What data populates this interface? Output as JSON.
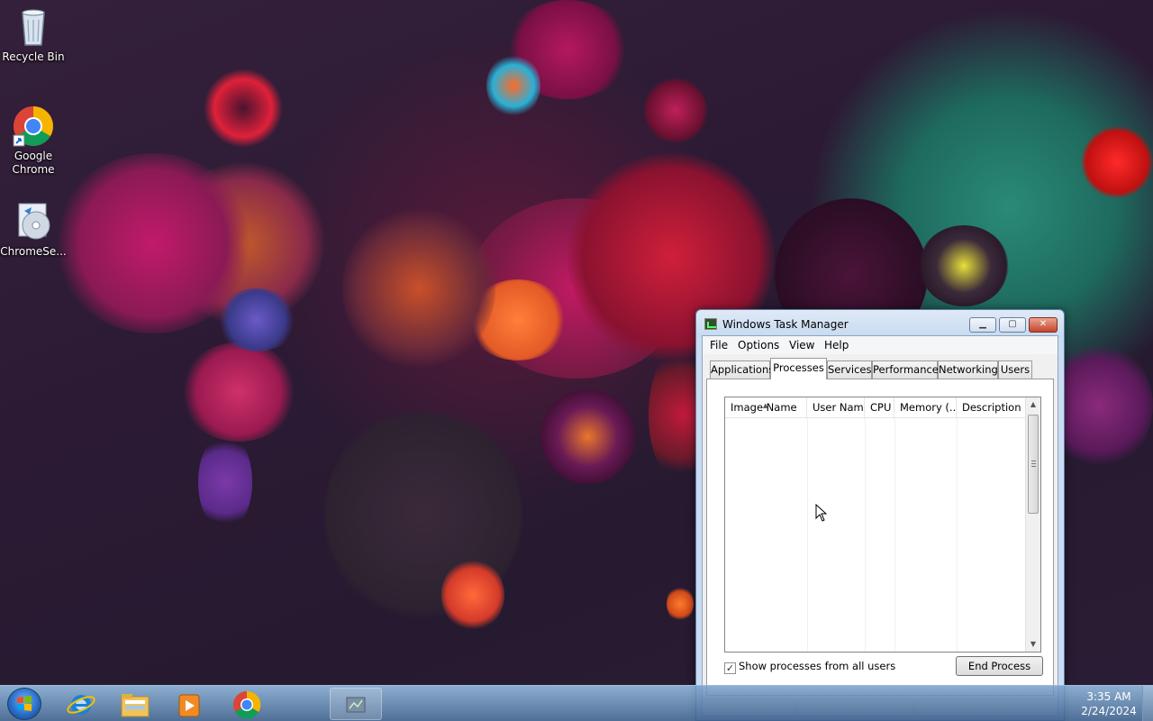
{
  "desktop": {
    "icons": [
      {
        "label": "Recycle Bin",
        "icon": "recycle-bin-icon"
      },
      {
        "label": "Google Chrome",
        "icon": "google-chrome-icon"
      },
      {
        "label": "ChromeSe...",
        "icon": "setup-disc-icon"
      }
    ]
  },
  "task_manager": {
    "title": "Windows Task Manager",
    "caption_buttons": {
      "minimize": "▁",
      "maximize": "▢",
      "close": "✕"
    },
    "menu": [
      "File",
      "Options",
      "View",
      "Help"
    ],
    "tabs": [
      "Applications",
      "Processes",
      "Services",
      "Performance",
      "Networking",
      "Users"
    ],
    "active_tab": "Processes",
    "columns": [
      "Image Name",
      "User Name",
      "CPU",
      "Memory (...",
      "Description"
    ],
    "rows": [],
    "sort_indicator": "▲",
    "show_all_label": "Show processes from all users",
    "show_all_checked": "✓",
    "end_process_label": "End Process"
  },
  "taskbar": {
    "pinned": [
      {
        "icon": "internet-explorer-icon"
      },
      {
        "icon": "windows-explorer-icon"
      },
      {
        "icon": "media-player-icon"
      },
      {
        "icon": "google-chrome-icon"
      },
      {
        "icon": "task-manager-icon"
      }
    ],
    "time": "3:35 AM",
    "date": "2/24/2024"
  },
  "colors": {
    "window_frame": "#c9dcf2",
    "taskbar": "#5b86b6",
    "close_button": "#c4452c"
  }
}
